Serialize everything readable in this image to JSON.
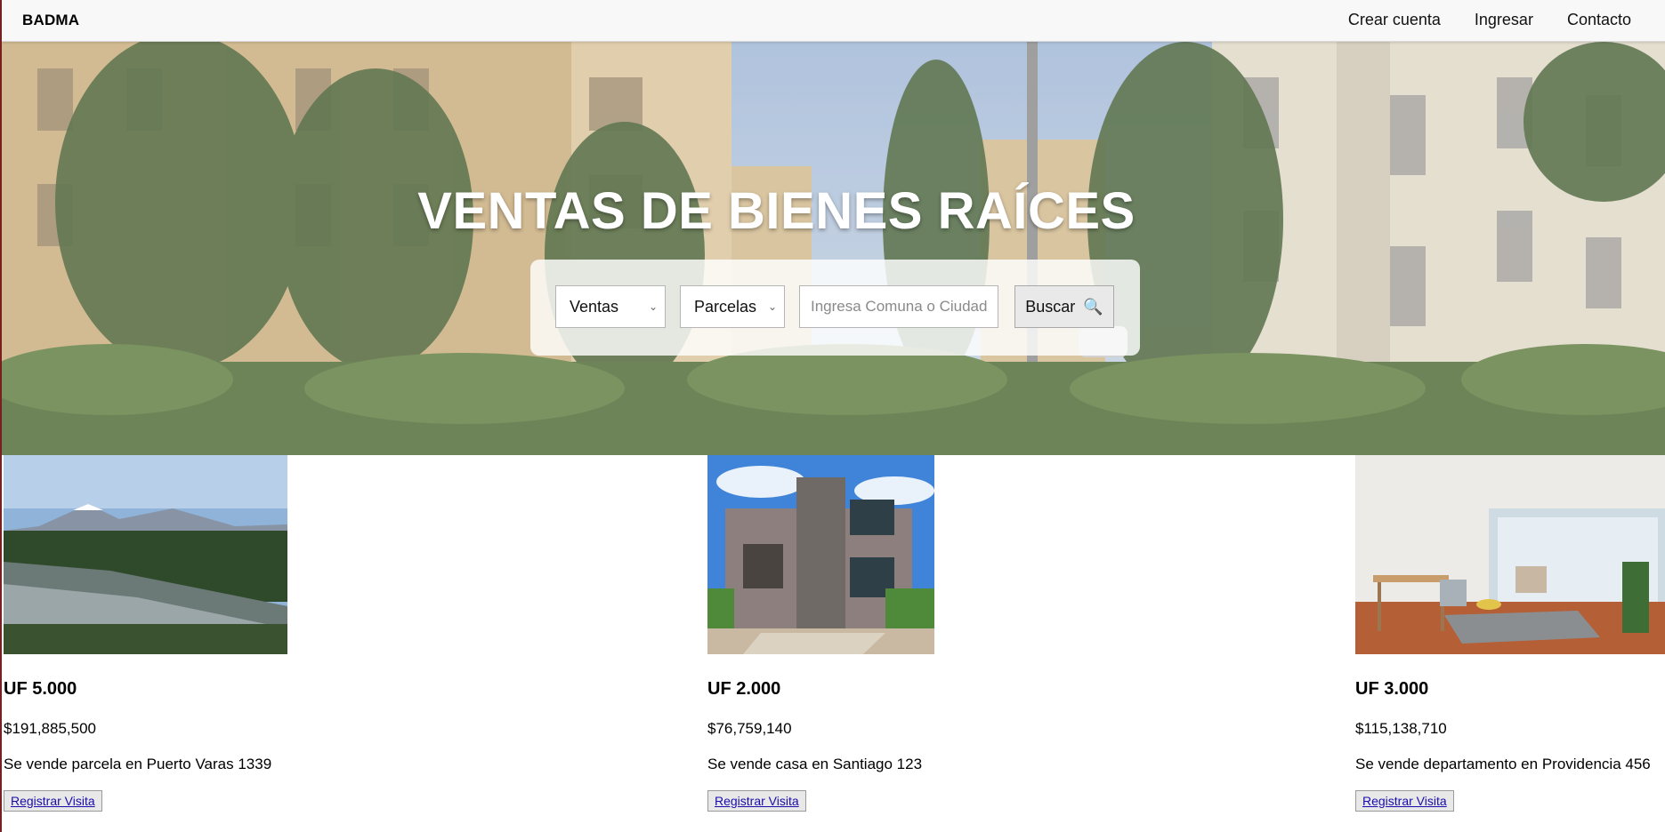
{
  "navbar": {
    "brand": "BADMA",
    "links": [
      "Crear cuenta",
      "Ingresar",
      "Contacto"
    ]
  },
  "hero": {
    "title": "VENTAS DE BIENES RAÍCES",
    "search": {
      "operation": {
        "selected": "Ventas"
      },
      "property_type": {
        "selected": "Parcelas"
      },
      "location_placeholder": "Ingresa Comuna o Ciudad",
      "button_label": "Buscar",
      "button_icon": "magnifier-icon"
    }
  },
  "listings": [
    {
      "image": "river-forest-volcano-photo",
      "price_uf": "UF 5.000",
      "price_clp": "$191,885,500",
      "description": "Se vende parcela en Puerto Varas 1339",
      "button_label": "Registrar Visita"
    },
    {
      "image": "modern-house-photo",
      "price_uf": "UF 2.000",
      "price_clp": "$76,759,140",
      "description": "Se vende casa en Santiago 123",
      "button_label": "Registrar Visita"
    },
    {
      "image": "apartment-interior-photo",
      "price_uf": "UF 3.000",
      "price_clp": "$115,138,710",
      "description": "Se vende departamento en Providencia 456",
      "button_label": "Registrar Visita"
    }
  ],
  "colors": {
    "navbar_bg": "#f8f8f8",
    "link_blue": "#1a0dab",
    "hero_title": "#ffffff"
  }
}
